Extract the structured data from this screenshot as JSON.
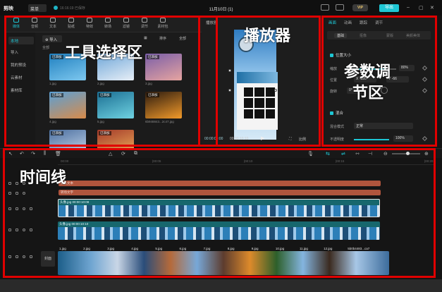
{
  "titlebar": {
    "app_name": "剪映",
    "menu_label": "菜单",
    "save_status": "16:16:19 已保存",
    "project_title": "11月10日 (1)",
    "vip_label": "VIP",
    "export_label": "导出"
  },
  "annotations": {
    "tools_zone": "工具选择区",
    "player_zone": "播放器",
    "props_zone_line1": "参数调",
    "props_zone_line2": "节区",
    "timeline_zone": "时间线"
  },
  "tools": {
    "tabs": [
      "媒体",
      "音频",
      "文本",
      "贴纸",
      "特效",
      "转场",
      "滤镜",
      "调节",
      "素材包"
    ],
    "side_items": [
      "本地",
      "导入",
      "我的预设",
      "云素材",
      "素材库"
    ],
    "import_label": "导入",
    "sort_label": "排序",
    "filter_label": "全部",
    "sub_label": "全部",
    "added_badge": "已添加",
    "thumbs": [
      {
        "name": "1.jpg",
        "colors": [
          "#1f7fbf",
          "#7ec8ef"
        ]
      },
      {
        "name": "2.jpg",
        "colors": [
          "#6fa7d9",
          "#e7eef6"
        ]
      },
      {
        "name": "3.jpg",
        "colors": [
          "#7a5ea8",
          "#e6a4a0"
        ]
      },
      {
        "name": "4.jpg",
        "colors": [
          "#5aa0d6",
          "#d88b4a"
        ]
      },
      {
        "name": "5.jpg",
        "colors": [
          "#1b6e93",
          "#6fd2e1"
        ]
      },
      {
        "name": "6b948843...2c47.jpg",
        "colors": [
          "#2c1b0f",
          "#f29a2a"
        ]
      },
      {
        "name": "7.jpg",
        "colors": [
          "#4b6fa0",
          "#c8d9ec"
        ]
      },
      {
        "name": "8.jpg",
        "colors": [
          "#a33a2a",
          "#f0b15a"
        ]
      }
    ]
  },
  "player": {
    "label": "播放器",
    "time_current": "00:00:00:00",
    "time_total": "00:00:10:10",
    "ratio_label": "比例"
  },
  "props": {
    "tabs": [
      "画面",
      "动画",
      "跟踪",
      "调节"
    ],
    "sub_tabs": [
      "基础",
      "抠像",
      "蒙版",
      "美颜美体"
    ],
    "section_position": "位置大小",
    "scale_label": "缩放",
    "scale_value": "80%",
    "position_label": "位置",
    "pos_x": "-895",
    "pos_y": "-66",
    "rotate_label": "旋转",
    "rotate_value": "0°",
    "section_blend": "混合",
    "blend_mode_label": "混合模式",
    "blend_mode_value": "正常",
    "opacity_label": "不透明度",
    "opacity_value": "100%",
    "opacity": 1.0
  },
  "timeline": {
    "ruler_ticks": [
      "00:00",
      "|00:05",
      "|00:10",
      "|00:15",
      "|00:20"
    ],
    "text_clip_1": "默认文本",
    "text_clip_2": "转场文字",
    "video_clip_1": "头像.jpg  00:00:10:08",
    "video_clip_2": "头像.jpg  00:00:10:10",
    "cover_label": "封面",
    "main_clips": [
      "1.jpg",
      "2.jpg",
      "3.jpg",
      "4.jpg",
      "5.jpg",
      "6.jpg",
      "7.jpg",
      "8.jpg",
      "9.jpg",
      "10.jpg",
      "11.jpg",
      "12.jpg",
      "5b0b4483...ca7"
    ]
  }
}
